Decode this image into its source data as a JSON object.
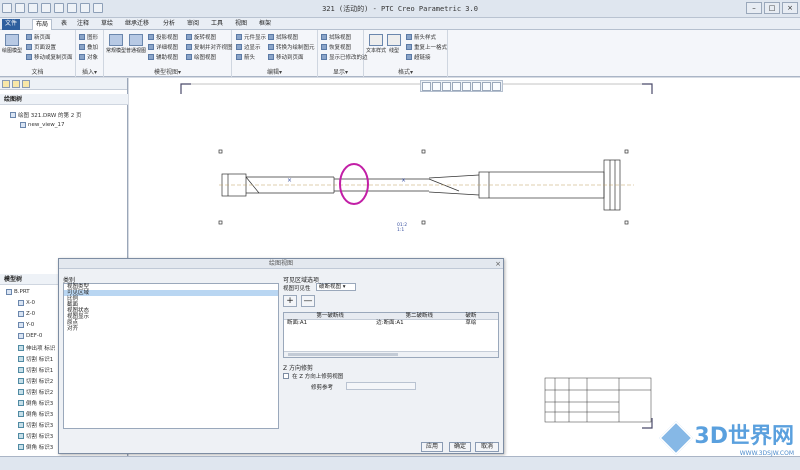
{
  "window": {
    "title": "321 (活动的) - PTC Creo Parametric 3.0",
    "controls": [
      "–",
      "□",
      "×"
    ]
  },
  "tabs": [
    "文件",
    "布局",
    "表",
    "注释",
    "草绘",
    "继承迁移",
    "分析",
    "审阅",
    "工具",
    "视图",
    "框架"
  ],
  "ribbon": {
    "doc_group": {
      "label": "文档",
      "big": "绘图模型",
      "items": [
        "新页面",
        "页面设置",
        "移动或复制页面"
      ]
    },
    "insert_group": {
      "label": "插入▾",
      "items": [
        "图形",
        "叠加",
        "对象"
      ]
    },
    "model_view_group": {
      "label": "模型视图▾",
      "big1": "常规模型",
      "big2": "普通视图",
      "items": [
        "投影视图",
        "详细视图",
        "辅助视图",
        "旋转视图",
        "复制并对齐视图",
        "绘图视图"
      ]
    },
    "edit_group": {
      "label": "编辑▾",
      "items": [
        "元件显示",
        "边显示",
        "箭头",
        "拭除视图",
        "转换为绘制图元",
        "移动到页面"
      ]
    },
    "display_group": {
      "label": "显示▾",
      "items": [
        "拭除视图",
        "恢复视图",
        "显示已修改的边"
      ]
    },
    "format_group": {
      "label": "格式▾",
      "big1": "文本样式",
      "big2": "线型",
      "items": [
        "箭头样式",
        "重复上一格式",
        "超链接"
      ]
    }
  },
  "left_panel": {
    "drawing_tree_title": "绘图树",
    "drawing_items": [
      "绘图 321.DRW 的第 2 页",
      "new_view_17"
    ],
    "model_tree_title": "模型树",
    "model_items": [
      "B.PRT",
      "X-0",
      "Z-0",
      "Y-0",
      "DEF-0",
      "伸出项 标识",
      "切割 标识1",
      "切割 标识1",
      "切割 标识2",
      "切割 标识2",
      "倒角 标识3",
      "倒角 标识3",
      "切割 标识3",
      "切割 标识3",
      "倒角 标识3"
    ]
  },
  "drawing": {
    "annotation_line1": "01:2",
    "annotation_line2": "1:1"
  },
  "dialog": {
    "title": "绘图视图",
    "category_label": "类别",
    "categories": [
      "视图类型",
      "可见区域",
      "比例",
      "截面",
      "视图状态",
      "视图显示",
      "原点",
      "对齐"
    ],
    "selected_category_index": 1,
    "visible_area_title": "可见区域选项",
    "view_visibility_label": "视图可见性",
    "view_visibility_value": "破断视图",
    "add_label": "+",
    "remove_label": "—",
    "table_headers": [
      "第一破断线",
      "第二破断线",
      "破断"
    ],
    "table_row": [
      "断面:A1",
      "边:断面:A1",
      "草绘"
    ],
    "z_section_title": "Z 方向修剪",
    "z_checkbox_label": "在 Z 方向上修剪视图",
    "z_ref_label": "修剪参考",
    "buttons": [
      "应用",
      "确定",
      "取消"
    ]
  },
  "watermark": {
    "text": "3D世界网",
    "url": "WWW.3DSJW.COM"
  }
}
